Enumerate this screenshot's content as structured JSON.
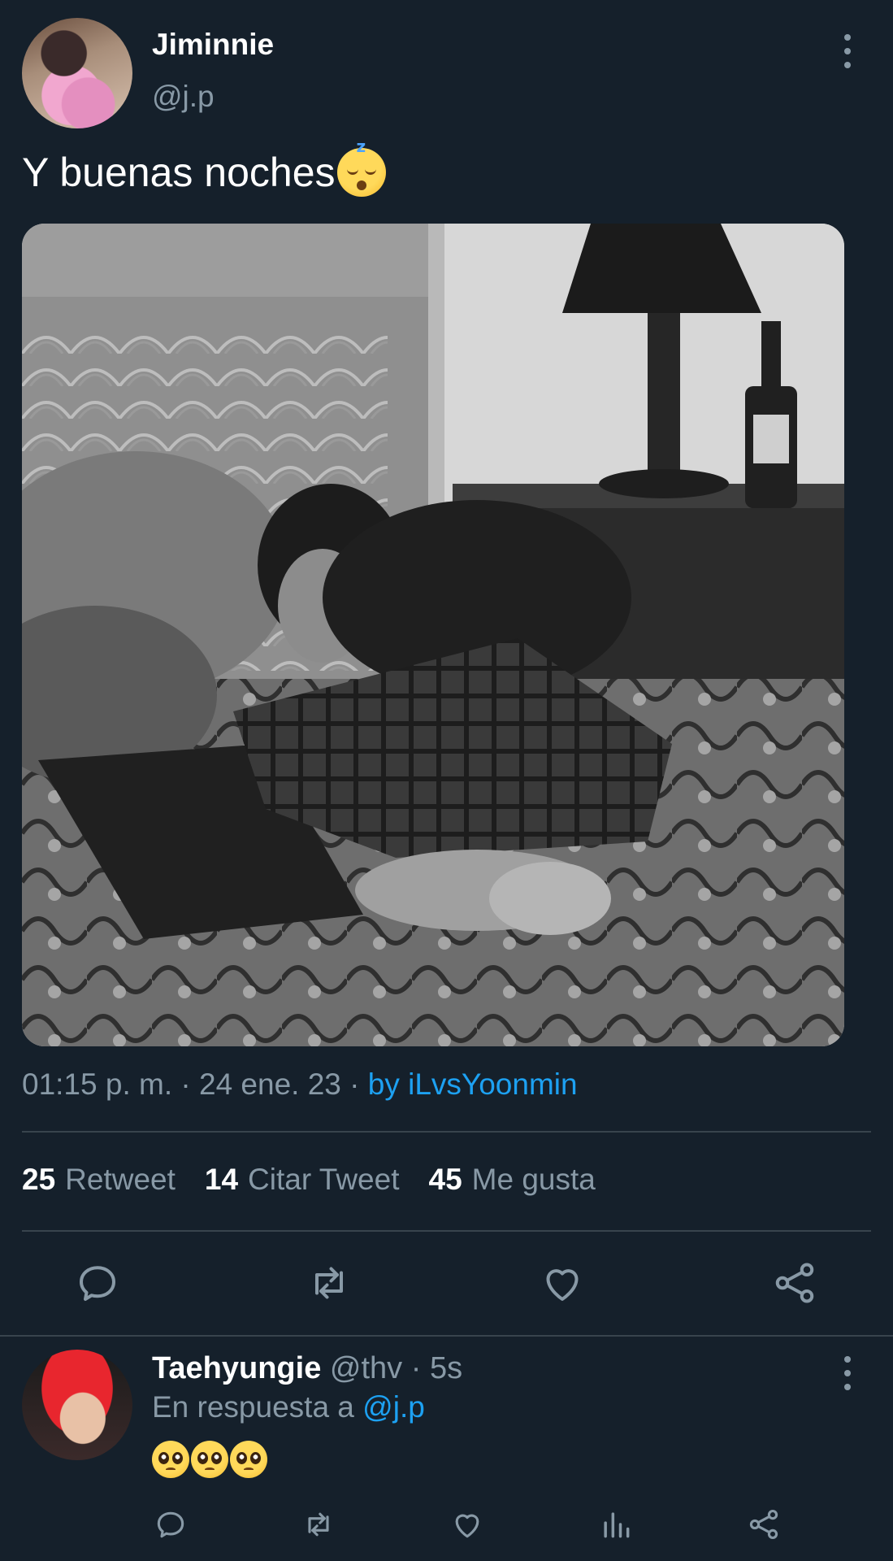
{
  "tweet": {
    "author": {
      "name": "Jiminnie",
      "handle": "@j.p"
    },
    "text": "Y buenas noches",
    "emoji": "sleeping-face",
    "media": {
      "description_icon": "photo"
    },
    "meta": {
      "time": "01:15 p. m.",
      "separator1": " · ",
      "date": "24 ene. 23",
      "separator2": " · ",
      "source": "by iLvsYoonmin"
    },
    "stats": [
      {
        "count": "25",
        "label": "Retweet"
      },
      {
        "count": "14",
        "label": "Citar Tweet"
      },
      {
        "count": "45",
        "label": "Me gusta"
      }
    ],
    "actions": [
      "reply-icon",
      "retweet-icon",
      "like-icon",
      "share-icon"
    ]
  },
  "reply": {
    "author": {
      "name": "Taehyungie",
      "handle": "@thv",
      "time": "5s",
      "separator": " · "
    },
    "reply_to_prefix": "En respuesta a ",
    "reply_to_handle": "@j.p",
    "emojis": [
      "pleading-face",
      "pleading-face",
      "pleading-face"
    ],
    "actions": [
      "reply-icon",
      "retweet-icon",
      "like-icon",
      "analytics-icon",
      "share-icon"
    ]
  },
  "colors": {
    "background": "#15202b",
    "secondary_text": "#8899a6",
    "accent": "#1da1f2",
    "divider": "#38444d"
  }
}
